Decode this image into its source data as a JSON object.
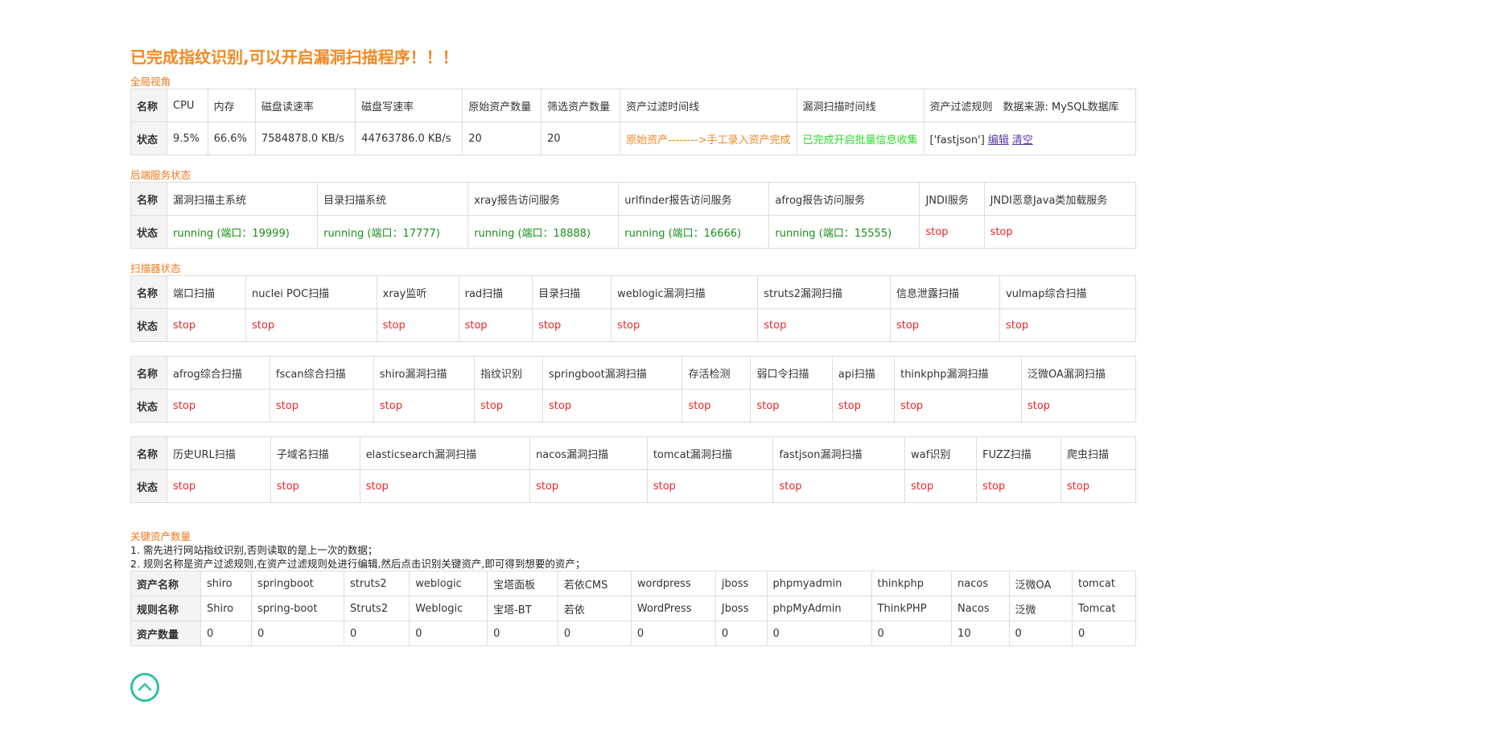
{
  "title": "已完成指纹识别,可以开启漏洞扫描程序！！！",
  "global": {
    "label": "全局视角",
    "header_label": "名称",
    "status_label": "状态",
    "cols": [
      "CPU",
      "内存",
      "磁盘读速率",
      "磁盘写速率",
      "原始资产数量",
      "筛选资产数量",
      "资产过滤时间线",
      "漏洞扫描时间线",
      "资产过滤规则　数据来源: MySQL数据库"
    ],
    "values": [
      "9.5%",
      "66.6%",
      "7584878.0 KB/s",
      "44763786.0 KB/s",
      "20",
      "20",
      "原始资产-------->手工录入资产完成",
      "已完成开启批量信息收集"
    ],
    "filter_rule": "['fastjson']",
    "edit_link": "编辑",
    "clear_link": "清空"
  },
  "backend": {
    "label": "后端服务状态",
    "names": [
      "漏洞扫描主系统",
      "目录扫描系统",
      "xray报告访问服务",
      "urlfinder报告访问服务",
      "afrog报告访问服务",
      "JNDI服务",
      "JNDI恶意Java类加载服务"
    ],
    "statuses": [
      "running (端口：19999)",
      "running (端口：17777)",
      "running (端口：18888)",
      "running (端口：16666)",
      "running (端口：15555)",
      "stop",
      "stop"
    ]
  },
  "scanner": {
    "label": "扫描器状态",
    "row1": {
      "names": [
        "端口扫描",
        "nuclei POC扫描",
        "xray监听",
        "rad扫描",
        "目录扫描",
        "weblogic漏洞扫描",
        "struts2漏洞扫描",
        "信息泄露扫描",
        "vulmap综合扫描"
      ],
      "statuses": [
        "stop",
        "stop",
        "stop",
        "stop",
        "stop",
        "stop",
        "stop",
        "stop",
        "stop"
      ]
    },
    "row2": {
      "names": [
        "afrog综合扫描",
        "fscan综合扫描",
        "shiro漏洞扫描",
        "指纹识别",
        "springboot漏洞扫描",
        "存活检测",
        "弱口令扫描",
        "api扫描",
        "thinkphp漏洞扫描",
        "泛微OA漏洞扫描"
      ],
      "statuses": [
        "stop",
        "stop",
        "stop",
        "stop",
        "stop",
        "stop",
        "stop",
        "stop",
        "stop",
        "stop"
      ]
    },
    "row3": {
      "names": [
        "历史URL扫描",
        "子域名扫描",
        "elasticsearch漏洞扫描",
        "nacos漏洞扫描",
        "tomcat漏洞扫描",
        "fastjson漏洞扫描",
        "waf识别",
        "FUZZ扫描",
        "爬虫扫描"
      ],
      "statuses": [
        "stop",
        "stop",
        "stop",
        "stop",
        "stop",
        "stop",
        "stop",
        "stop",
        "stop"
      ]
    }
  },
  "key_assets": {
    "label": "关键资产数量",
    "note1": "1. 需先进行网站指纹识别,否则读取的是上一次的数据；",
    "note2": "2. 规则名称是资产过滤规则,在资产过滤规则处进行编辑,然后点击识别关键资产,即可得到想要的资产；",
    "row_labels": [
      "资产名称",
      "规则名称",
      "资产数量"
    ],
    "asset_names": [
      "shiro",
      "springboot",
      "struts2",
      "weblogic",
      "宝塔面板",
      "若依CMS",
      "wordpress",
      "jboss",
      "phpmyadmin",
      "thinkphp",
      "nacos",
      "泛微OA",
      "tomcat"
    ],
    "rule_names": [
      "Shiro",
      "spring-boot",
      "Struts2",
      "Weblogic",
      "宝塔-BT",
      "若依",
      "WordPress",
      "Jboss",
      "phpMyAdmin",
      "ThinkPHP",
      "Nacos",
      "泛微",
      "Tomcat"
    ],
    "counts": [
      "0",
      "0",
      "0",
      "0",
      "0",
      "0",
      "0",
      "0",
      "0",
      "0",
      "10",
      "0",
      "0"
    ]
  },
  "icons": {
    "back_to_top": "chevron-up-circle-icon"
  },
  "colors": {
    "title": "#f5871f",
    "running": "#1a8f1a",
    "stop": "#e8262a",
    "timeline_green": "#2adc2a",
    "top_button": "#2ec4a0"
  }
}
